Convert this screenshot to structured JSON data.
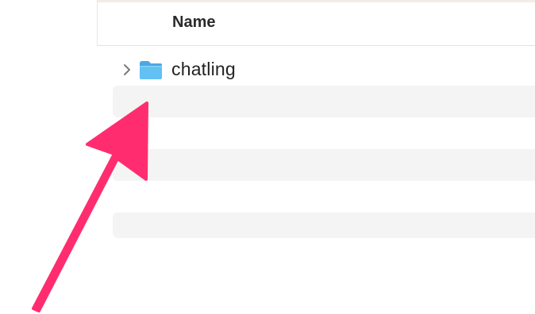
{
  "list": {
    "column_header": "Name",
    "items": [
      {
        "name": "chatling",
        "type": "folder",
        "expanded": false
      }
    ]
  },
  "icons": {
    "disclosure": "chevron-right-icon",
    "item": "folder-icon"
  },
  "colors": {
    "folder": "#5ab8ef",
    "annotation_arrow": "#ff2d6f",
    "alt_row": "#f4f4f4"
  }
}
